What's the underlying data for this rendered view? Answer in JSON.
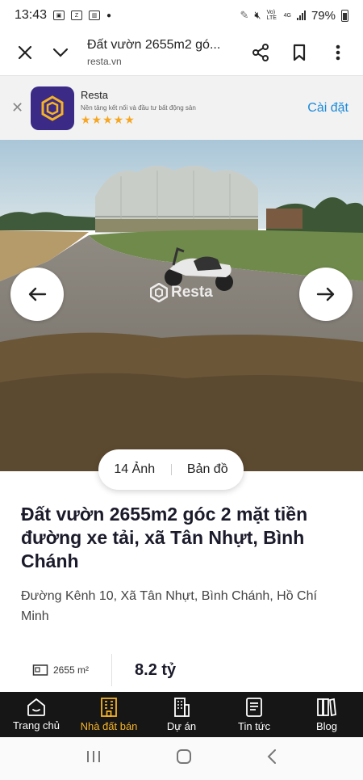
{
  "status_bar": {
    "time": "13:43",
    "battery": "79%",
    "network_label": "Vo) LTE",
    "network_type": "4G"
  },
  "browser": {
    "page_title": "Đất vườn 2655m2 gó...",
    "domain": "resta.vn"
  },
  "app_banner": {
    "name": "Resta",
    "description": "Nền tảng kết nối và đầu tư bất động sản",
    "stars": "★★★★★",
    "install_label": "Cài đặt",
    "accent": "#1b8ad9"
  },
  "photo": {
    "watermark": "Resta",
    "tabs": [
      {
        "label": "14 Ảnh"
      },
      {
        "label": "Bản đồ"
      }
    ]
  },
  "listing": {
    "title": "Đất vườn 2655m2 góc 2 mặt tiền đường xe tải, xã Tân Nhựt, Bình Chánh",
    "address": "Đường Kênh 10, Xã Tân Nhựt, Bình Chánh, Hồ Chí Minh",
    "area": "2655 m²",
    "price": "8.2 tỷ"
  },
  "bottom_nav": {
    "active_color": "#f5b324",
    "items": [
      {
        "label": "Trang chủ",
        "icon": "home-icon"
      },
      {
        "label": "Nhà đất bán",
        "icon": "building-icon"
      },
      {
        "label": "Dự án",
        "icon": "project-icon"
      },
      {
        "label": "Tin tức",
        "icon": "news-icon"
      },
      {
        "label": "Blog",
        "icon": "blog-icon"
      }
    ]
  }
}
